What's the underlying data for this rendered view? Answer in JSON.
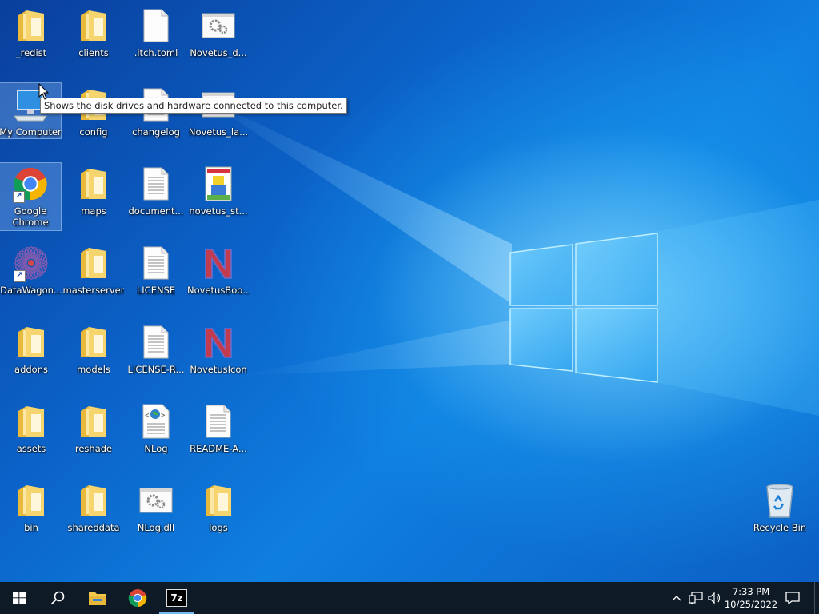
{
  "desktop": {
    "icons": [
      {
        "label": "_redist",
        "type": "folder"
      },
      {
        "label": "clients",
        "type": "folder"
      },
      {
        "label": ".itch.toml",
        "type": "file"
      },
      {
        "label": "Novetus_d...",
        "type": "gear-file"
      },
      {
        "label": "My Computer",
        "type": "computer"
      },
      {
        "label": "config",
        "type": "folder"
      },
      {
        "label": "changelog",
        "type": "text-file"
      },
      {
        "label": "Novetus_la...",
        "type": "gear-file"
      },
      {
        "label": "Google Chrome",
        "type": "chrome"
      },
      {
        "label": "maps",
        "type": "folder"
      },
      {
        "label": "document...",
        "type": "text-file"
      },
      {
        "label": "novetus_st...",
        "type": "novetus-image"
      },
      {
        "label": "DataWagon...",
        "type": "datawagon"
      },
      {
        "label": "masterserver",
        "type": "folder"
      },
      {
        "label": "LICENSE",
        "type": "text-file"
      },
      {
        "label": "NovetusBoo...",
        "type": "novetus-n"
      },
      {
        "label": "addons",
        "type": "folder"
      },
      {
        "label": "models",
        "type": "folder"
      },
      {
        "label": "LICENSE-R...",
        "type": "text-file"
      },
      {
        "label": "NovetusIcon",
        "type": "novetus-n"
      },
      {
        "label": "assets",
        "type": "folder"
      },
      {
        "label": "reshade",
        "type": "folder"
      },
      {
        "label": "NLog",
        "type": "nlog"
      },
      {
        "label": "README-A...",
        "type": "text-file"
      },
      {
        "label": "bin",
        "type": "folder"
      },
      {
        "label": "shareddata",
        "type": "folder"
      },
      {
        "label": "NLog.dll",
        "type": "gear-file"
      },
      {
        "label": "logs",
        "type": "folder"
      }
    ],
    "recycle_bin": "Recycle Bin",
    "tooltip": "Shows the disk drives and hardware connected to this computer."
  },
  "taskbar": {
    "start": "start-icon",
    "search": "search-icon",
    "apps": [
      "file-explorer-icon",
      "chrome-icon",
      "7zip-icon"
    ],
    "sevenzip_label": "7z",
    "clock_time": "7:33 PM",
    "clock_date": "10/25/2022"
  }
}
